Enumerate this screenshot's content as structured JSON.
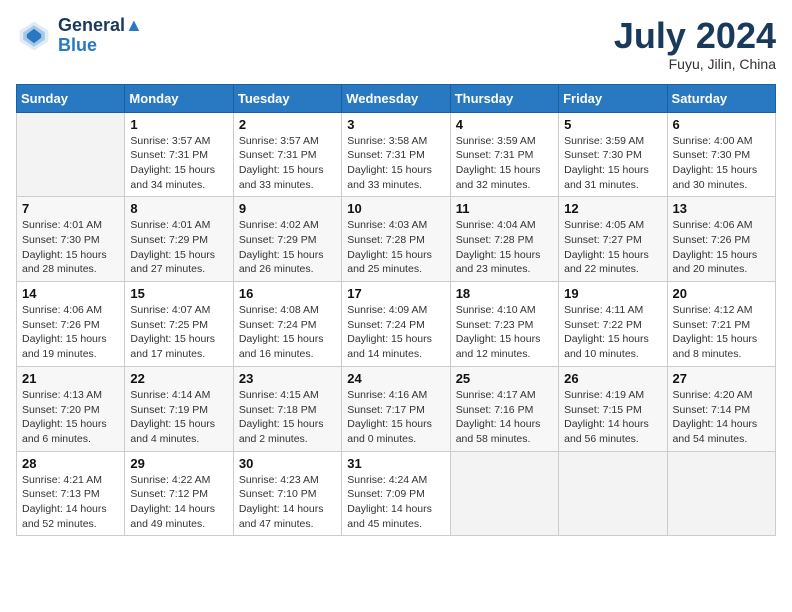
{
  "header": {
    "logo_line1": "General",
    "logo_line2": "Blue",
    "month_year": "July 2024",
    "location": "Fuyu, Jilin, China"
  },
  "days_of_week": [
    "Sunday",
    "Monday",
    "Tuesday",
    "Wednesday",
    "Thursday",
    "Friday",
    "Saturday"
  ],
  "weeks": [
    [
      {
        "num": "",
        "empty": true
      },
      {
        "num": "1",
        "sunrise": "Sunrise: 3:57 AM",
        "sunset": "Sunset: 7:31 PM",
        "daylight": "Daylight: 15 hours and 34 minutes."
      },
      {
        "num": "2",
        "sunrise": "Sunrise: 3:57 AM",
        "sunset": "Sunset: 7:31 PM",
        "daylight": "Daylight: 15 hours and 33 minutes."
      },
      {
        "num": "3",
        "sunrise": "Sunrise: 3:58 AM",
        "sunset": "Sunset: 7:31 PM",
        "daylight": "Daylight: 15 hours and 33 minutes."
      },
      {
        "num": "4",
        "sunrise": "Sunrise: 3:59 AM",
        "sunset": "Sunset: 7:31 PM",
        "daylight": "Daylight: 15 hours and 32 minutes."
      },
      {
        "num": "5",
        "sunrise": "Sunrise: 3:59 AM",
        "sunset": "Sunset: 7:30 PM",
        "daylight": "Daylight: 15 hours and 31 minutes."
      },
      {
        "num": "6",
        "sunrise": "Sunrise: 4:00 AM",
        "sunset": "Sunset: 7:30 PM",
        "daylight": "Daylight: 15 hours and 30 minutes."
      }
    ],
    [
      {
        "num": "7",
        "sunrise": "Sunrise: 4:01 AM",
        "sunset": "Sunset: 7:30 PM",
        "daylight": "Daylight: 15 hours and 28 minutes."
      },
      {
        "num": "8",
        "sunrise": "Sunrise: 4:01 AM",
        "sunset": "Sunset: 7:29 PM",
        "daylight": "Daylight: 15 hours and 27 minutes."
      },
      {
        "num": "9",
        "sunrise": "Sunrise: 4:02 AM",
        "sunset": "Sunset: 7:29 PM",
        "daylight": "Daylight: 15 hours and 26 minutes."
      },
      {
        "num": "10",
        "sunrise": "Sunrise: 4:03 AM",
        "sunset": "Sunset: 7:28 PM",
        "daylight": "Daylight: 15 hours and 25 minutes."
      },
      {
        "num": "11",
        "sunrise": "Sunrise: 4:04 AM",
        "sunset": "Sunset: 7:28 PM",
        "daylight": "Daylight: 15 hours and 23 minutes."
      },
      {
        "num": "12",
        "sunrise": "Sunrise: 4:05 AM",
        "sunset": "Sunset: 7:27 PM",
        "daylight": "Daylight: 15 hours and 22 minutes."
      },
      {
        "num": "13",
        "sunrise": "Sunrise: 4:06 AM",
        "sunset": "Sunset: 7:26 PM",
        "daylight": "Daylight: 15 hours and 20 minutes."
      }
    ],
    [
      {
        "num": "14",
        "sunrise": "Sunrise: 4:06 AM",
        "sunset": "Sunset: 7:26 PM",
        "daylight": "Daylight: 15 hours and 19 minutes."
      },
      {
        "num": "15",
        "sunrise": "Sunrise: 4:07 AM",
        "sunset": "Sunset: 7:25 PM",
        "daylight": "Daylight: 15 hours and 17 minutes."
      },
      {
        "num": "16",
        "sunrise": "Sunrise: 4:08 AM",
        "sunset": "Sunset: 7:24 PM",
        "daylight": "Daylight: 15 hours and 16 minutes."
      },
      {
        "num": "17",
        "sunrise": "Sunrise: 4:09 AM",
        "sunset": "Sunset: 7:24 PM",
        "daylight": "Daylight: 15 hours and 14 minutes."
      },
      {
        "num": "18",
        "sunrise": "Sunrise: 4:10 AM",
        "sunset": "Sunset: 7:23 PM",
        "daylight": "Daylight: 15 hours and 12 minutes."
      },
      {
        "num": "19",
        "sunrise": "Sunrise: 4:11 AM",
        "sunset": "Sunset: 7:22 PM",
        "daylight": "Daylight: 15 hours and 10 minutes."
      },
      {
        "num": "20",
        "sunrise": "Sunrise: 4:12 AM",
        "sunset": "Sunset: 7:21 PM",
        "daylight": "Daylight: 15 hours and 8 minutes."
      }
    ],
    [
      {
        "num": "21",
        "sunrise": "Sunrise: 4:13 AM",
        "sunset": "Sunset: 7:20 PM",
        "daylight": "Daylight: 15 hours and 6 minutes."
      },
      {
        "num": "22",
        "sunrise": "Sunrise: 4:14 AM",
        "sunset": "Sunset: 7:19 PM",
        "daylight": "Daylight: 15 hours and 4 minutes."
      },
      {
        "num": "23",
        "sunrise": "Sunrise: 4:15 AM",
        "sunset": "Sunset: 7:18 PM",
        "daylight": "Daylight: 15 hours and 2 minutes."
      },
      {
        "num": "24",
        "sunrise": "Sunrise: 4:16 AM",
        "sunset": "Sunset: 7:17 PM",
        "daylight": "Daylight: 15 hours and 0 minutes."
      },
      {
        "num": "25",
        "sunrise": "Sunrise: 4:17 AM",
        "sunset": "Sunset: 7:16 PM",
        "daylight": "Daylight: 14 hours and 58 minutes."
      },
      {
        "num": "26",
        "sunrise": "Sunrise: 4:19 AM",
        "sunset": "Sunset: 7:15 PM",
        "daylight": "Daylight: 14 hours and 56 minutes."
      },
      {
        "num": "27",
        "sunrise": "Sunrise: 4:20 AM",
        "sunset": "Sunset: 7:14 PM",
        "daylight": "Daylight: 14 hours and 54 minutes."
      }
    ],
    [
      {
        "num": "28",
        "sunrise": "Sunrise: 4:21 AM",
        "sunset": "Sunset: 7:13 PM",
        "daylight": "Daylight: 14 hours and 52 minutes."
      },
      {
        "num": "29",
        "sunrise": "Sunrise: 4:22 AM",
        "sunset": "Sunset: 7:12 PM",
        "daylight": "Daylight: 14 hours and 49 minutes."
      },
      {
        "num": "30",
        "sunrise": "Sunrise: 4:23 AM",
        "sunset": "Sunset: 7:10 PM",
        "daylight": "Daylight: 14 hours and 47 minutes."
      },
      {
        "num": "31",
        "sunrise": "Sunrise: 4:24 AM",
        "sunset": "Sunset: 7:09 PM",
        "daylight": "Daylight: 14 hours and 45 minutes."
      },
      {
        "num": "",
        "empty": true
      },
      {
        "num": "",
        "empty": true
      },
      {
        "num": "",
        "empty": true
      }
    ]
  ]
}
